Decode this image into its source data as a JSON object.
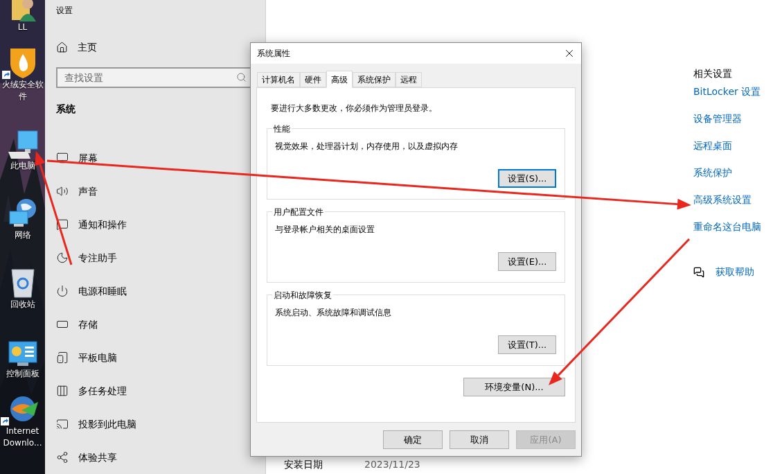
{
  "desktop": {
    "icons": [
      {
        "label": "LL",
        "kind": "user",
        "shortcut": false
      },
      {
        "label": "火绒安全软件",
        "kind": "shield",
        "shortcut": true
      },
      {
        "label": "此电脑",
        "kind": "computer",
        "shortcut": false
      },
      {
        "label": "网络",
        "kind": "network",
        "shortcut": false
      },
      {
        "label": "回收站",
        "kind": "recycle",
        "shortcut": false
      },
      {
        "label": "控制面板",
        "kind": "control",
        "shortcut": false
      },
      {
        "label": "Internet Downlo...",
        "kind": "download",
        "shortcut": true
      }
    ]
  },
  "settings": {
    "title": "设置",
    "home": "主页",
    "search": {
      "placeholder": "查找设置"
    },
    "section": "系统",
    "items": [
      {
        "label": "屏幕",
        "kind": "display"
      },
      {
        "label": "声音",
        "kind": "sound"
      },
      {
        "label": "通知和操作",
        "kind": "notifications"
      },
      {
        "label": "专注助手",
        "kind": "focus"
      },
      {
        "label": "电源和睡眠",
        "kind": "power"
      },
      {
        "label": "存储",
        "kind": "storage"
      },
      {
        "label": "平板电脑",
        "kind": "tablet"
      },
      {
        "label": "多任务处理",
        "kind": "multitask"
      },
      {
        "label": "投影到此电脑",
        "kind": "project"
      },
      {
        "label": "体验共享",
        "kind": "shared"
      }
    ]
  },
  "main": {
    "related": {
      "heading": "相关设置",
      "links": [
        "BitLocker 设置",
        "设备管理器",
        "远程桌面",
        "系统保护",
        "高级系统设置",
        "重命名这台电脑"
      ]
    },
    "help": "获取帮助",
    "install": {
      "label": "安装日期",
      "value": "2023/11/23"
    }
  },
  "dialog": {
    "title": "系统属性",
    "tabs": [
      {
        "label": "计算机名",
        "selected": false
      },
      {
        "label": "硬件",
        "selected": false
      },
      {
        "label": "高级",
        "selected": true
      },
      {
        "label": "系统保护",
        "selected": false
      },
      {
        "label": "远程",
        "selected": false
      }
    ],
    "notice": "要进行大多数更改，你必须作为管理员登录。",
    "groups": [
      {
        "title": "性能",
        "description": "视觉效果，处理器计划，内存使用，以及虚拟内存",
        "button": "设置(S)...",
        "focused": true
      },
      {
        "title": "用户配置文件",
        "description": "与登录帐户相关的桌面设置",
        "button": "设置(E)...",
        "focused": false
      },
      {
        "title": "启动和故障恢复",
        "description": "系统启动、系统故障和调试信息",
        "button": "设置(T)...",
        "focused": false
      }
    ],
    "env_button": "环境变量(N)...",
    "buttons": [
      {
        "label": "确定",
        "disabled": false
      },
      {
        "label": "取消",
        "disabled": false
      },
      {
        "label": "应用(A)",
        "disabled": true
      }
    ]
  }
}
